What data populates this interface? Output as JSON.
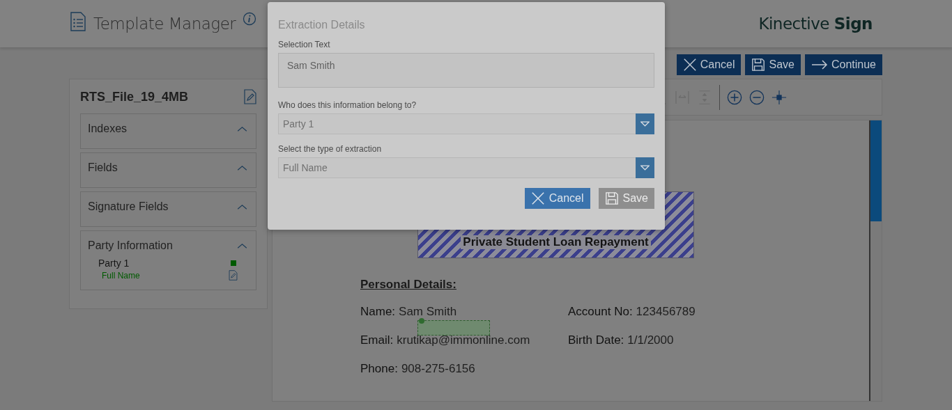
{
  "header": {
    "title": "Template Manager",
    "brand_light": "Kinective",
    "brand_bold": "Sign"
  },
  "actions": [
    {
      "label": "Cancel",
      "kind": "cancel"
    },
    {
      "label": "Save",
      "kind": "save"
    },
    {
      "label": "Continue",
      "kind": "continue"
    }
  ],
  "sidebar": {
    "file_name": "RTS_File_19_4MB",
    "sections": [
      {
        "title": "Indexes",
        "expanded": true
      },
      {
        "title": "Fields",
        "expanded": true
      },
      {
        "title": "Signature Fields",
        "expanded": true
      },
      {
        "title": "Party Information",
        "expanded": true,
        "parties": [
          {
            "name": "Party 1",
            "color": "#005a00",
            "fields": [
              "Full Name"
            ]
          }
        ]
      }
    ]
  },
  "document": {
    "banner_title": "Private Student Loan Repayment",
    "heading": "Personal Details:",
    "rows": [
      [
        {
          "label": "Name:",
          "value": "Sam Smith"
        },
        {
          "label": "Account No:",
          "value": "123456789"
        }
      ],
      [
        {
          "label": "Email:",
          "value": "krutikap@immonline.com"
        },
        {
          "label": "Birth Date:",
          "value": "1/1/2000"
        }
      ],
      [
        {
          "label": "Phone:",
          "value": "908-275-6156"
        }
      ]
    ]
  },
  "modal": {
    "title": "Extraction Details",
    "selection_label": "Selection Text",
    "selection_value": "Sam Smith",
    "owner_label": "Who does this information belong to?",
    "owner_value": "Party 1",
    "type_label": "Select the type of extraction",
    "type_value": "Full Name",
    "buttons": [
      {
        "label": "Cancel",
        "kind": "cancel",
        "disabled": false
      },
      {
        "label": "Save",
        "kind": "save",
        "disabled": true
      }
    ]
  }
}
